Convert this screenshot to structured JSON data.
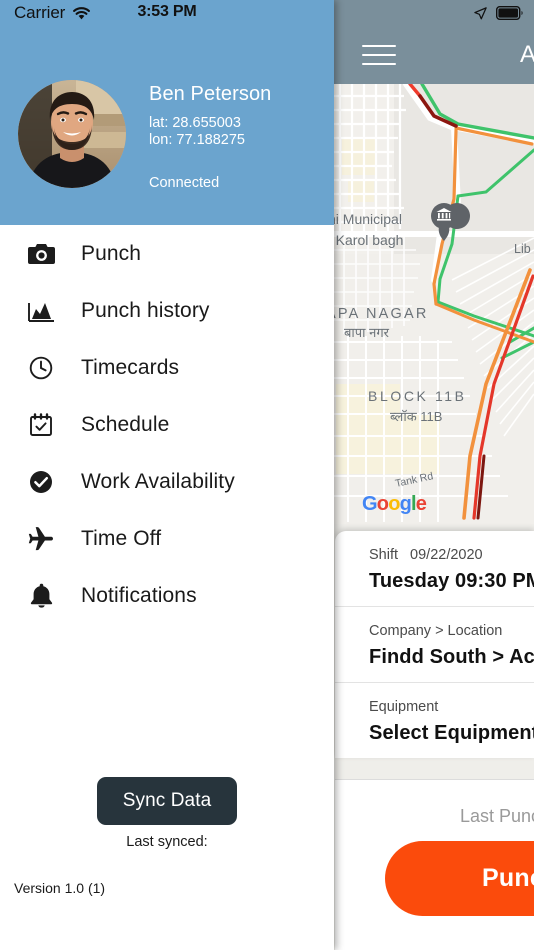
{
  "drawer": {
    "status_bar": {
      "carrier": "Carrier",
      "wifi_icon": "wifi-icon",
      "time": "3:53 PM"
    },
    "profile": {
      "avatar_icon": "user-avatar-photo",
      "name": "Ben Peterson",
      "lat_line": "lat: 28.655003",
      "lon_line": "lon: 77.188275",
      "connection_status": "Connected"
    },
    "menu_items": [
      {
        "icon": "camera-icon",
        "label": "Punch"
      },
      {
        "icon": "chart-area-icon",
        "label": "Punch history"
      },
      {
        "icon": "clock-icon",
        "label": "Timecards"
      },
      {
        "icon": "calendar-check-icon",
        "label": "Schedule"
      },
      {
        "icon": "check-circle-icon",
        "label": "Work Availability"
      },
      {
        "icon": "airplane-icon",
        "label": "Time Off"
      },
      {
        "icon": "bell-icon",
        "label": "Notifications"
      }
    ],
    "footer": {
      "sync_button": "Sync Data",
      "last_synced": "Last synced:",
      "version": "Version 1.0 (1)"
    },
    "colors": {
      "header_blue": "#6BA4CE",
      "sync_button": "#27343C"
    }
  },
  "main": {
    "status_bar": {
      "location_icon": "location-arrow-icon",
      "battery_icon": "battery-full-icon"
    },
    "navbar": {
      "menu_icon": "hamburger-menu-icon",
      "title": "Ac"
    },
    "map": {
      "provider_logo": [
        "G",
        "o",
        "o",
        "g",
        "l",
        "e"
      ],
      "labels": [
        "Lib",
        "hi Municipal",
        "n Karol bagh",
        "APA NAGAR",
        "बापा नगर",
        "BLOCK 11B",
        "ब्लॉक 11B",
        "Tank Rd"
      ],
      "marker_icon": "bank-place-marker-icon"
    },
    "shift_card": {
      "rows": [
        {
          "label": "Shift",
          "label_extra": "09/22/2020",
          "value": "Tuesday  09:30 PM"
        },
        {
          "label": "Company",
          "separator": ">",
          "label_extra": "Location",
          "value": "Findd South > Ace"
        },
        {
          "label": "Equipment",
          "value": "Select Equipment"
        }
      ]
    },
    "punch": {
      "last_punch_label": "Last Punch",
      "punch_button": "Punc"
    },
    "colors": {
      "navbar_gray": "#7A8F9B",
      "punch_orange": "#FB4B0C"
    }
  }
}
